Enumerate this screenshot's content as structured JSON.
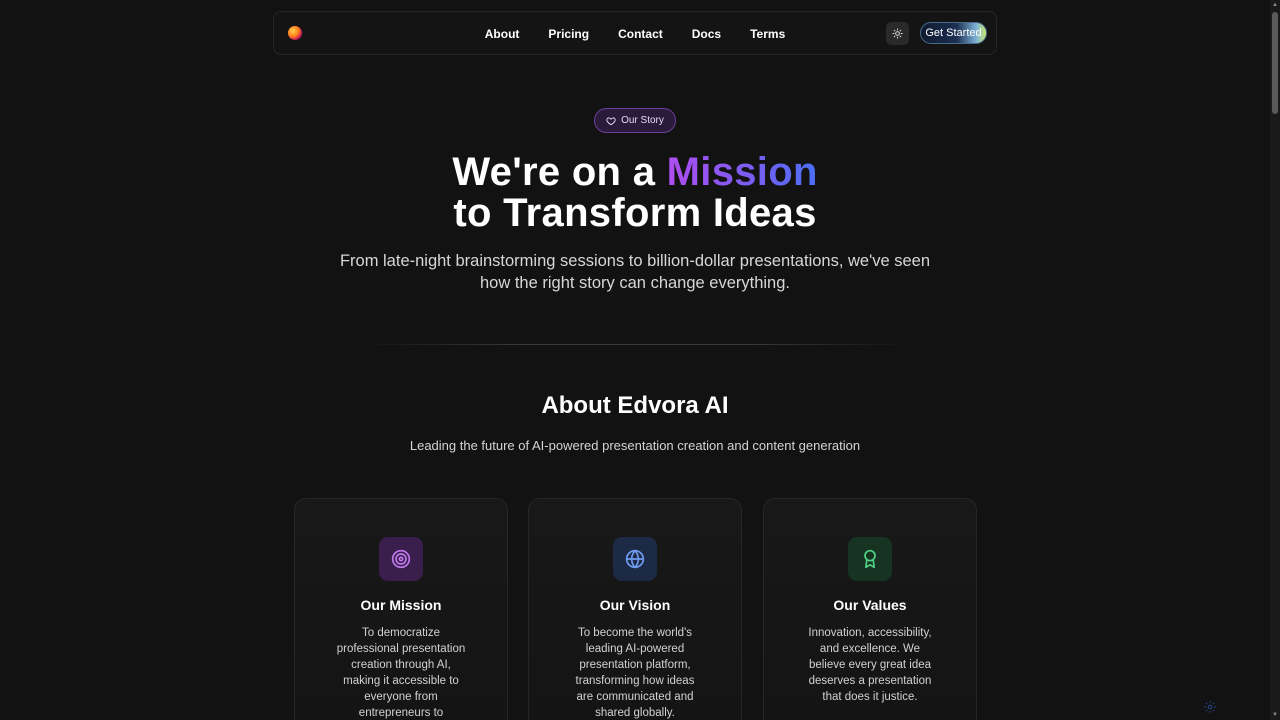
{
  "nav": {
    "links": [
      "About",
      "Pricing",
      "Contact",
      "Docs",
      "Terms"
    ],
    "cta_label": "Get Started"
  },
  "hero": {
    "badge": "Our Story",
    "title_part1": "We're on a ",
    "title_highlight": "Mission",
    "title_line2": "to Transform Ideas",
    "subtitle": "From late-night brainstorming sessions to billion-dollar presentations, we've seen how the right story can change everything."
  },
  "about": {
    "title": "About Edvora AI",
    "subtitle": "Leading the future of AI-powered presentation creation and content generation",
    "cards": [
      {
        "title": "Our Mission",
        "text": "To democratize professional presentation creation through AI, making it accessible to everyone from entrepreneurs to",
        "icon": "target-icon",
        "accent": "#c07af0"
      },
      {
        "title": "Our Vision",
        "text": "To become the world's leading AI-powered presentation platform, transforming how ideas are communicated and shared globally.",
        "icon": "globe-icon",
        "accent": "#6f9bf0"
      },
      {
        "title": "Our Values",
        "text": "Innovation, accessibility, and excellence. We believe every great idea deserves a presentation that does it justice.",
        "icon": "award-icon",
        "accent": "#4fd486"
      }
    ]
  }
}
